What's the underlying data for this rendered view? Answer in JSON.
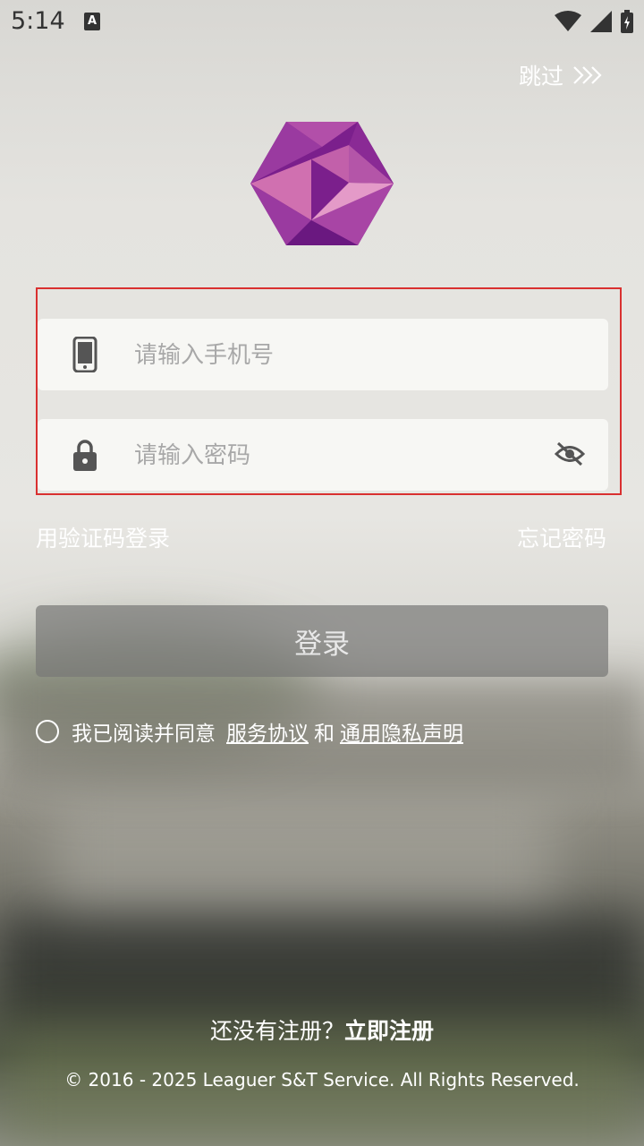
{
  "status_bar": {
    "time": "5:14",
    "notification_icon": "A"
  },
  "header": {
    "skip_label": "跳过",
    "skip_arrows": ">>>"
  },
  "form": {
    "phone_placeholder": "请输入手机号",
    "password_placeholder": "请输入密码"
  },
  "links": {
    "sms_login": "用验证码登录",
    "forgot_password": "忘记密码"
  },
  "login_button": "登录",
  "agreement": {
    "prefix": "我已阅读并同意",
    "service": "服务协议",
    "and": "和",
    "privacy": "通用隐私声明"
  },
  "register": {
    "prompt": "还没有注册？",
    "action": "立即注册"
  },
  "footer": {
    "copyright": "© 2016 - 2025 Leaguer S&T Service. All Rights Reserved."
  },
  "colors": {
    "logo_dark": "#7b1f8c",
    "logo_light": "#d070b0",
    "highlight": "#d93030"
  }
}
